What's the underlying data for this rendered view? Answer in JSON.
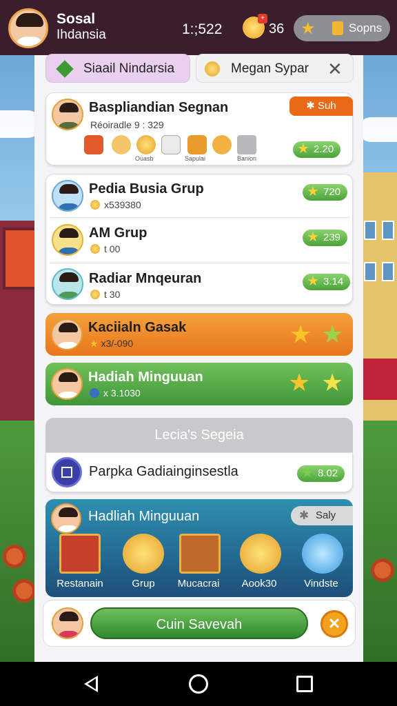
{
  "topbar": {
    "title_line1": "Sosal",
    "title_line2": "Ihdansia",
    "clock": "1:;522",
    "coin_count": "36",
    "pill_label": "Sopns"
  },
  "tabs": [
    {
      "label": "Siaail Nindarsia"
    },
    {
      "label": "Megan Sypar"
    }
  ],
  "featured": {
    "name": "Baspliandian Segnan",
    "subtitle": "Réoiradle 9 : 329",
    "tag": "Suh",
    "score": "2.20",
    "items": [
      {
        "label": ""
      },
      {
        "label": ""
      },
      {
        "label": "Ouasb"
      },
      {
        "label": ""
      },
      {
        "label": "Sapulai"
      },
      {
        "label": ""
      },
      {
        "label": "Banion"
      }
    ]
  },
  "groups": [
    {
      "name": "Pedia Busia Grup",
      "detail": "x539380",
      "score": "720"
    },
    {
      "name": "AM Grup",
      "detail": "t 00",
      "score": "239"
    },
    {
      "name": "Radiar Mnqeuran",
      "detail": "t 30",
      "score": "3.14"
    }
  ],
  "banners": [
    {
      "name": "Kaciialn Gasak",
      "detail": "x3/-090",
      "color": "#e8761c"
    },
    {
      "name": "Hadiah Minguuan",
      "detail": "x 3.1030",
      "color": "#3f9638"
    }
  ],
  "section_title": "Lecia's Segeia",
  "special": {
    "name": "Parpka Gadiainginsestla",
    "score": "8.02"
  },
  "reward": {
    "title": "Hadliah Minguuan",
    "badge": "Saly",
    "items": [
      {
        "label": "Restanain"
      },
      {
        "label": "Grup"
      },
      {
        "label": "Mucacrai"
      },
      {
        "label": "Aook30"
      },
      {
        "label": "Vindste"
      }
    ]
  },
  "cta": {
    "label": "Cuin Savevah"
  }
}
